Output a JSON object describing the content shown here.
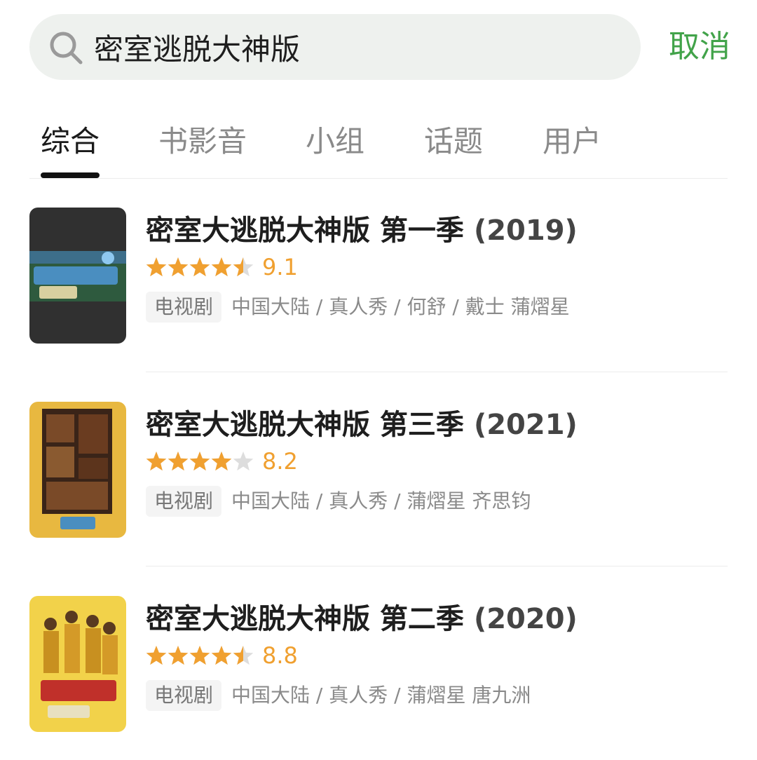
{
  "search": {
    "query": "密室逃脱大神版",
    "icon": "search-icon",
    "cancel_label": "取消"
  },
  "colors": {
    "accent": "#42a34a",
    "star": "#f0a030",
    "star_empty": "#dddddd",
    "search_bg": "#eef1ee"
  },
  "tabs": [
    {
      "label": "综合",
      "active": true
    },
    {
      "label": "书影音",
      "active": false
    },
    {
      "label": "小组",
      "active": false
    },
    {
      "label": "话题",
      "active": false
    },
    {
      "label": "用户",
      "active": false
    }
  ],
  "results": [
    {
      "title": "密室大逃脱大神版 第一季",
      "year": "(2019)",
      "rating_stars": 4.5,
      "score": "9.1",
      "type": "电视剧",
      "meta": "中国大陆 / 真人秀 / 何舒 / 戴士 蒲熠星"
    },
    {
      "title": "密室大逃脱大神版 第三季",
      "year": "(2021)",
      "rating_stars": 4,
      "score": "8.2",
      "type": "电视剧",
      "meta": "中国大陆 / 真人秀 / 蒲熠星 齐思钧"
    },
    {
      "title": "密室大逃脱大神版 第二季",
      "year": "(2020)",
      "rating_stars": 4.5,
      "score": "8.8",
      "type": "电视剧",
      "meta": "中国大陆 / 真人秀 / 蒲熠星 唐九洲"
    }
  ]
}
